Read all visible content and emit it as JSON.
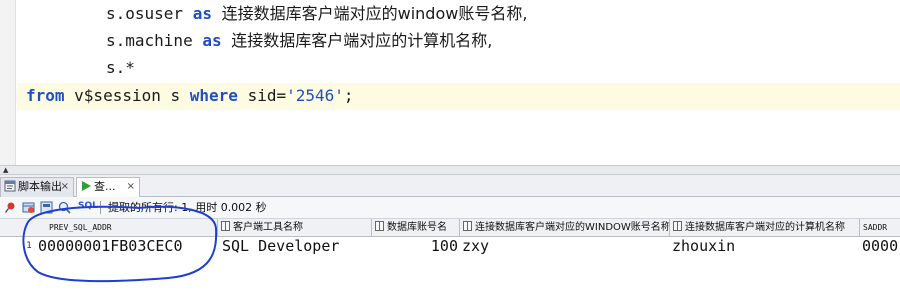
{
  "editor": {
    "lines": [
      {
        "p1": "s.osuser ",
        "kw1": "as",
        "p2": " ",
        "cn": "连接数据库客户端对应的window账号名称,"
      },
      {
        "p1": "s.machine ",
        "kw1": "as",
        "p2": " ",
        "cn": "连接数据库客户端对应的计算机名称,"
      },
      {
        "p1": "s.*"
      },
      {
        "kw1": "from",
        "p1": " v$session s ",
        "kw2": "where",
        "p2": " sid=",
        "str": "'2546'",
        "p3": ";"
      }
    ]
  },
  "tabs": [
    {
      "label": "脚本输出",
      "icon": "script-output-icon"
    },
    {
      "label": "查...",
      "icon": "query-result-icon"
    }
  ],
  "toolbar": {
    "sql_label": "SQL",
    "status": "提取的所有行: 1, 用时 0.002 秒"
  },
  "grid": {
    "columns": [
      "PREV_SQL_ADDR",
      "客户端工具名称",
      "数据库账号名",
      "连接数据库客户端对应的WINDOW账号名称",
      "连接数据库客户端对应的计算机名称",
      "SADDR"
    ],
    "rows": [
      {
        "num": "1",
        "cells": [
          "00000001FB03CEC0",
          "SQL Developer",
          "100",
          "zxy",
          "zhouxin",
          "0000"
        ]
      }
    ]
  },
  "colors": {
    "keyword": "#1f4fc4",
    "current_line": "#fdfce2",
    "annotation": "#1e3fcf"
  }
}
